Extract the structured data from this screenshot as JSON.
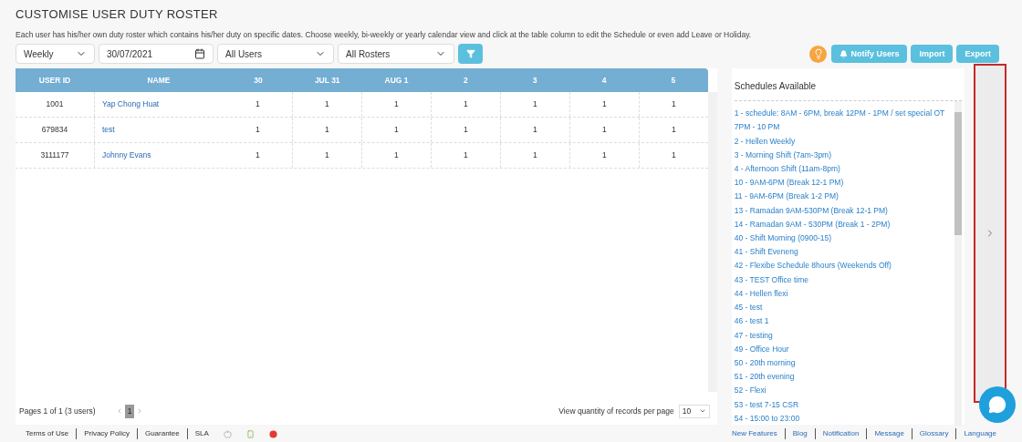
{
  "page": {
    "title": "CUSTOMISE USER DUTY ROSTER",
    "description": "Each user has his/her own duty roster which contains his/her duty on specific dates. Choose weekly, bi-weekly or yearly calendar view and click at the table column to edit the Schedule or even add Leave or Holiday."
  },
  "filters": {
    "period": "Weekly",
    "date": "30/07/2021",
    "users": "All Users",
    "rosters": "All Rosters"
  },
  "actions": [
    {
      "kind": "notify",
      "label": "Notify Users"
    },
    {
      "kind": "plain",
      "label": "Import"
    },
    {
      "kind": "plain",
      "label": "Export"
    }
  ],
  "table": {
    "columns": [
      "USER ID",
      "NAME",
      "30",
      "JUL 31",
      "AUG 1",
      "2",
      "3",
      "4",
      "5"
    ],
    "rows": [
      {
        "cells": [
          "1001",
          "Yap Chong Huat",
          "1",
          "1",
          "1",
          "1",
          "1",
          "1",
          "1"
        ]
      },
      {
        "cells": [
          "679834",
          "test",
          "1",
          "1",
          "1",
          "1",
          "1",
          "1",
          "1"
        ]
      },
      {
        "cells": [
          "3111177",
          "Johnny Evans",
          "1",
          "1",
          "1",
          "1",
          "1",
          "1",
          "1"
        ]
      }
    ]
  },
  "pagination": {
    "summary": "Pages 1 of 1 (3 users)",
    "pages": [
      {
        "label": "1",
        "selected": true
      }
    ],
    "per_page_label": "View quantity of records per page",
    "per_page": "10"
  },
  "schedules": {
    "title": "Schedules Available",
    "items": [
      "1 - schedule: 8AM - 6PM, break 12PM - 1PM / set special OT 7PM - 10 PM",
      "2 - Hellen Weekly",
      "3 - Morning Shift (7am-3pm)",
      "4 - Afternoon Shift (11am-8pm)",
      "10 - 9AM-6PM (Break 12-1 PM)",
      "11 - 9AM-6PM (Break 1-2 PM)",
      "13 - Ramadan 9AM-530PM (Break 12-1 PM)",
      "14 - Ramadan 9AM - 530PM (Break 1 - 2PM)",
      "40 - Shift Morning (0900-15)",
      "41 - Shift Eveneng",
      "42 - Flexibe Schedule 8hours (Weekends Off)",
      "43 - TEST Office time",
      "44 - Hellen flexi",
      "45 - test",
      "46 - test 1",
      "47 - testing",
      "49 - Office Hour",
      "50 - 20th morning",
      "51 - 20th evening",
      "52 - Flexi",
      "53 - test 7-15 CSR",
      "54 - 15:00 to 23:00"
    ]
  },
  "footer": {
    "left_links": [
      "Terms of Use",
      "Privacy Policy",
      "Guarantee",
      "SLA"
    ],
    "right_links": [
      "New Features",
      "Blog",
      "Notification",
      "Message",
      "Glossary",
      "Language"
    ]
  }
}
